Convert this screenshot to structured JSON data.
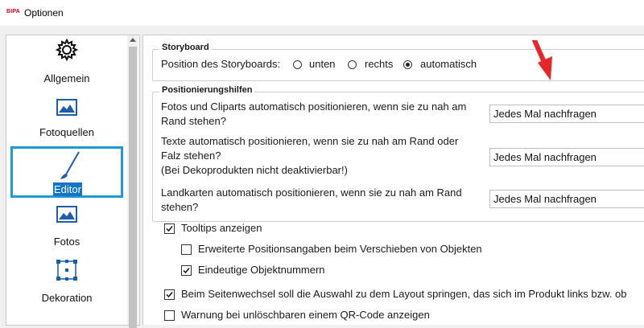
{
  "window": {
    "logo_text": "BIPA",
    "title": "Optionen"
  },
  "sidebar": {
    "items": [
      {
        "label": "Allgemein",
        "icon": "gear-icon"
      },
      {
        "label": "Fotoquellen",
        "icon": "photo-icon"
      },
      {
        "label": "Editor",
        "icon": "brush-icon",
        "selected": true
      },
      {
        "label": "Fotos",
        "icon": "photo-icon"
      },
      {
        "label": "Dekoration",
        "icon": "selection-frame-icon"
      }
    ],
    "selected_color": "#1e9ad6"
  },
  "storyboard": {
    "group_title": "Storyboard",
    "position_label": "Position des Storyboards:",
    "options": [
      {
        "label": "unten",
        "checked": false
      },
      {
        "label": "rechts",
        "checked": false
      },
      {
        "label": "automatisch",
        "checked": true
      }
    ]
  },
  "positioning": {
    "group_title": "Positionierungshilfen",
    "rows": [
      {
        "text1": "Fotos und Cliparts automatisch positionieren, wenn sie zu nah am",
        "text2": "Rand stehen?",
        "value": "Jedes Mal nachfragen"
      },
      {
        "text1": "Texte automatisch positionieren, wenn sie zu nah am Rand oder",
        "text2": "Falz stehen?",
        "text3": "(Bei Dekoprodukten nicht deaktivierbar!)",
        "value": "Jedes Mal nachfragen"
      },
      {
        "text1": "Landkarten automatisch positionieren, wenn sie zu nah am Rand",
        "text2": "stehen?",
        "value": "Jedes Mal nachfragen"
      }
    ]
  },
  "checkboxes": [
    {
      "label": "Tooltips anzeigen",
      "checked": true
    },
    {
      "label": "Erweiterte Positionsangaben beim Verschieben von Objekten",
      "checked": false
    },
    {
      "label": "Eindeutige Objektnummern",
      "checked": true
    },
    {
      "label": "Beim Seitenwechsel soll die Auswahl zu dem Layout springen, das sich im Produkt links bzw. ob",
      "checked": true
    },
    {
      "label": "Warnung bei unlöschbaren einem QR-Code anzeigen",
      "checked": false
    }
  ],
  "annotation": {
    "arrow_color": "#e8262a"
  }
}
